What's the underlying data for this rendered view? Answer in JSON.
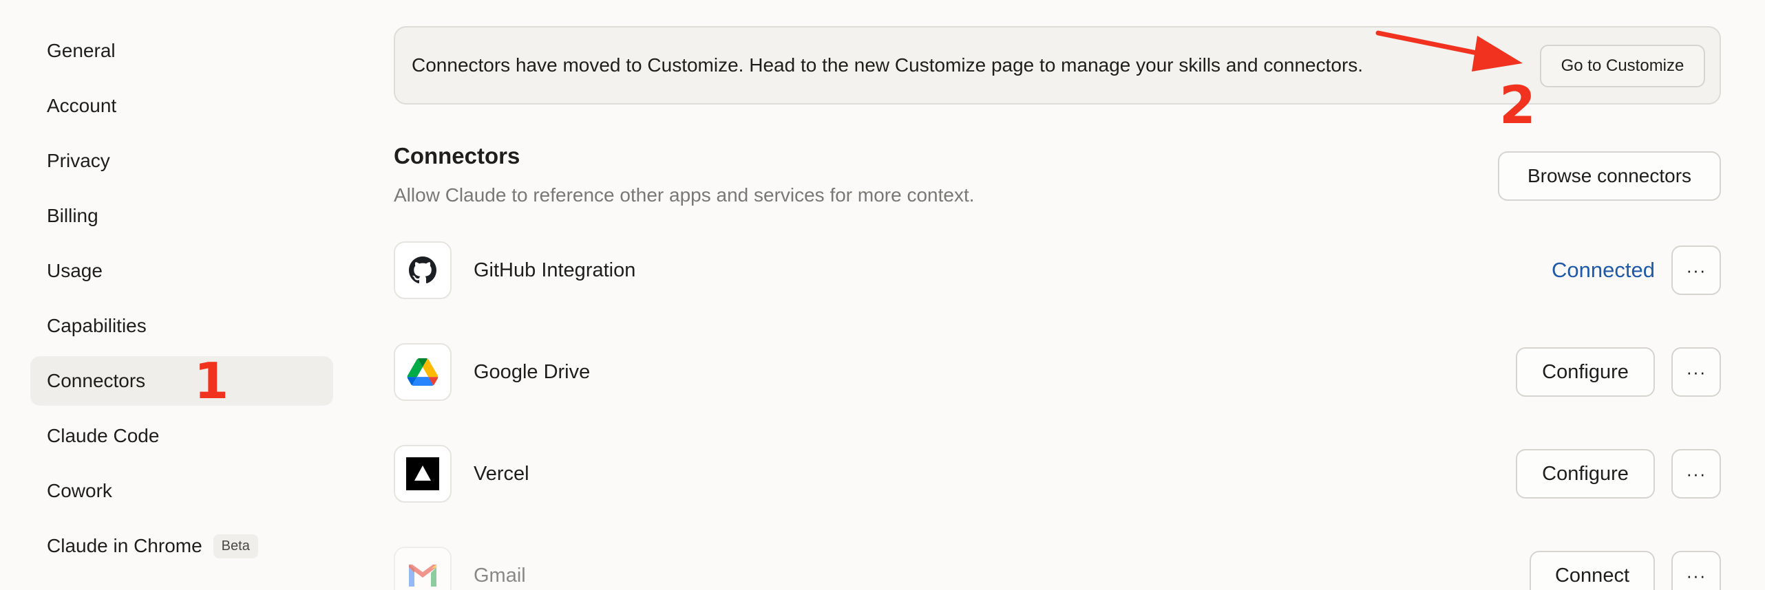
{
  "sidebar": {
    "items": [
      {
        "label": "General"
      },
      {
        "label": "Account"
      },
      {
        "label": "Privacy"
      },
      {
        "label": "Billing"
      },
      {
        "label": "Usage"
      },
      {
        "label": "Capabilities"
      },
      {
        "label": "Connectors",
        "active": true
      },
      {
        "label": "Claude Code"
      },
      {
        "label": "Cowork"
      },
      {
        "label": "Claude in Chrome",
        "badge": "Beta"
      }
    ]
  },
  "banner": {
    "text": "Connectors have moved to Customize. Head to the new Customize page to manage your skills and connectors.",
    "button_label": "Go to Customize"
  },
  "connectors_section": {
    "title": "Connectors",
    "subtitle": "Allow Claude to reference other apps and services for more context.",
    "browse_label": "Browse connectors"
  },
  "connectors": [
    {
      "name": "GitHub Integration",
      "icon": "github-icon",
      "status": "Connected"
    },
    {
      "name": "Google Drive",
      "icon": "google-drive-icon",
      "action": "Configure"
    },
    {
      "name": "Vercel",
      "icon": "vercel-icon",
      "action": "Configure"
    },
    {
      "name": "Gmail",
      "icon": "gmail-icon",
      "action": "Connect"
    }
  ],
  "more_glyph": "···",
  "annotations": {
    "step1": "1",
    "step2": "2",
    "color": "#f0321e"
  },
  "colors": {
    "connected": "#1e5aa8",
    "background": "#fbfaf8",
    "active_nav": "#efeeeb"
  }
}
